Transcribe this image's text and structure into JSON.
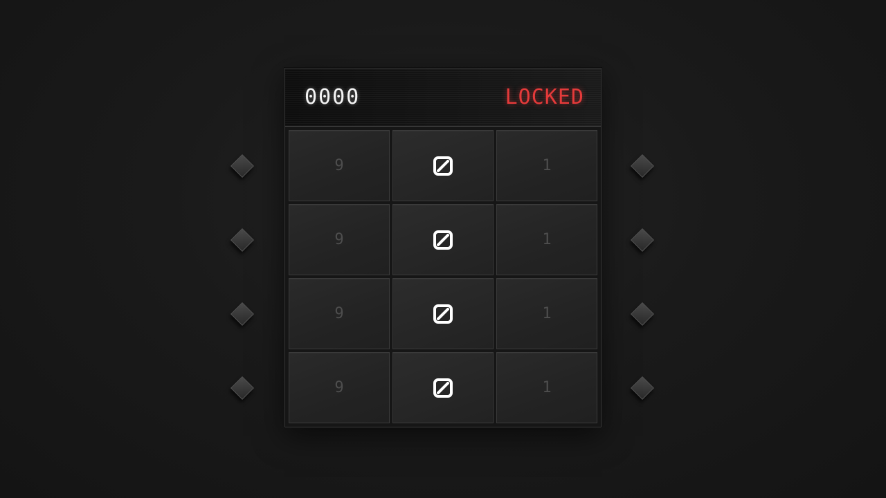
{
  "header": {
    "code": "0000",
    "status": "LOCKED"
  },
  "rows": [
    {
      "prev_digit": "9",
      "current_digit_icon": "slashed-zero-icon",
      "next_digit": "1"
    },
    {
      "prev_digit": "9",
      "current_digit_icon": "slashed-zero-icon",
      "next_digit": "1"
    },
    {
      "prev_digit": "9",
      "current_digit_icon": "slashed-zero-icon",
      "next_digit": "1"
    },
    {
      "prev_digit": "9",
      "current_digit_icon": "slashed-zero-icon",
      "next_digit": "1"
    }
  ],
  "colors": {
    "status_locked": "#e53a3a",
    "code_text": "#f4f4f4",
    "dim_digit": "#4e4e4e"
  }
}
